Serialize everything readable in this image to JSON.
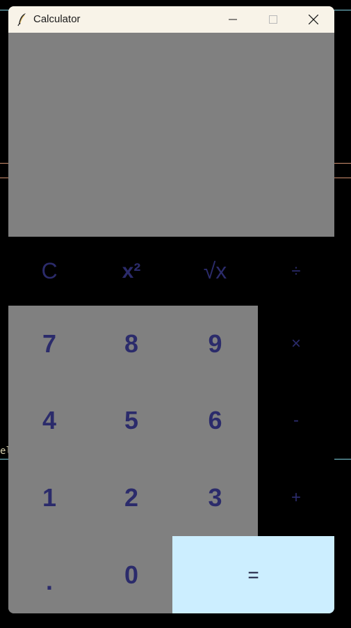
{
  "window": {
    "title": "Calculator",
    "controls": {
      "minimize": "minimize",
      "maximize": "maximize",
      "close": "close"
    }
  },
  "display": {
    "value": ""
  },
  "function_keys": [
    "C",
    "x²",
    "√x",
    "÷"
  ],
  "number_rows": [
    [
      "7",
      "8",
      "9"
    ],
    [
      "4",
      "5",
      "6"
    ],
    [
      "1",
      "2",
      "3"
    ]
  ],
  "operator_keys": [
    "×",
    "-",
    "+"
  ],
  "bottom_keys": {
    "decimal": ".",
    "zero": "0",
    "equals": "="
  },
  "background": {
    "partial_text": "el"
  },
  "colors": {
    "window_bg": "#808080",
    "titlebar_bg": "#f8f3e8",
    "key_text": "#2b2b6b",
    "equals_bg": "#cceeff",
    "dark_key_bg": "#000000"
  }
}
